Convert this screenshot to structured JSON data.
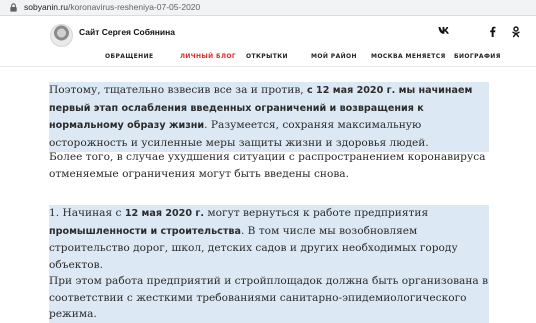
{
  "browser": {
    "url_host": "sobyanin.ru",
    "url_path": "/koronavirus-resheniya-07-05-2020"
  },
  "site": {
    "title": "Сайт Сергея Собянина",
    "social": [
      {
        "name": "vk-icon",
        "glyph": "vk"
      },
      {
        "name": "facebook-icon",
        "glyph": "f"
      },
      {
        "name": "odnoklassniki-icon",
        "glyph": "ok"
      }
    ],
    "nav": [
      "ОБРАЩЕНИЕ",
      "ЛИЧНЫЙ БЛОГ",
      "ОТКРЫТКИ",
      "МОЙ РАЙОН",
      "МОСКВА МЕНЯЕТСЯ",
      "БИОГРАФИЯ"
    ],
    "nav_active": "ЛИЧНЫЙ БЛОГ"
  },
  "article": {
    "p1": {
      "t1": "Поэтому, тщательно взвесив все за и против, ",
      "b1": "с 12 мая 2020 г. мы начинаем первый этап ослабления введенных ограничений и возвращения к нормальному образу жизни",
      "t2": ". Разумеется, сохраняя максимальную осторожность и усиленные меры защиты жизни и здоровья людей."
    },
    "p2": "Более того, в случае ухудшения ситуации с распространением коронавируса отменяемые ограничения могут быть введены снова.",
    "p3": {
      "t1": "1. Начиная с ",
      "b1": "12 мая 2020 г.",
      "t2": " могут вернуться к работе предприятия ",
      "b2": "промышленности и строительства",
      "t3": ". В том числе мы возобновляем строительство дорог, школ, детских садов и других необходимых городу объектов."
    },
    "p4": "При этом работа предприятий и стройплощадок должна быть организована в соответствии с жесткими требованиями санитарно-эпидемиологического режима."
  },
  "colors": {
    "highlight": "#dce9f5",
    "nav_active": "#e0262c",
    "text": "#2b2b2b"
  }
}
